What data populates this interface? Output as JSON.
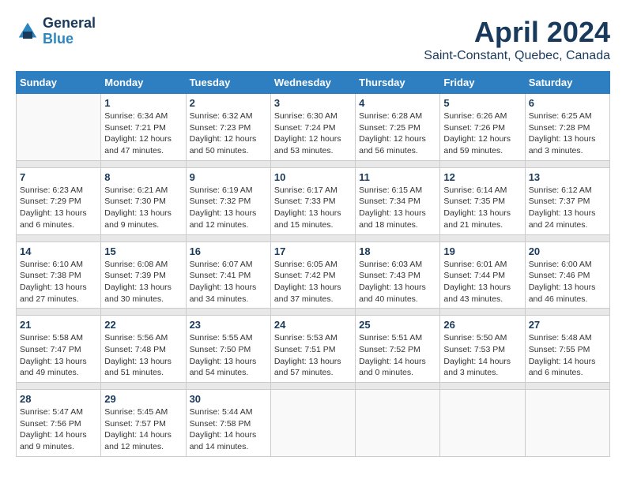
{
  "header": {
    "logo_line1": "General",
    "logo_line2": "Blue",
    "title": "April 2024",
    "subtitle": "Saint-Constant, Quebec, Canada"
  },
  "days_of_week": [
    "Sunday",
    "Monday",
    "Tuesday",
    "Wednesday",
    "Thursday",
    "Friday",
    "Saturday"
  ],
  "weeks": [
    [
      {
        "day": "",
        "sunrise": "",
        "sunset": "",
        "daylight": ""
      },
      {
        "day": "1",
        "sunrise": "Sunrise: 6:34 AM",
        "sunset": "Sunset: 7:21 PM",
        "daylight": "Daylight: 12 hours and 47 minutes."
      },
      {
        "day": "2",
        "sunrise": "Sunrise: 6:32 AM",
        "sunset": "Sunset: 7:23 PM",
        "daylight": "Daylight: 12 hours and 50 minutes."
      },
      {
        "day": "3",
        "sunrise": "Sunrise: 6:30 AM",
        "sunset": "Sunset: 7:24 PM",
        "daylight": "Daylight: 12 hours and 53 minutes."
      },
      {
        "day": "4",
        "sunrise": "Sunrise: 6:28 AM",
        "sunset": "Sunset: 7:25 PM",
        "daylight": "Daylight: 12 hours and 56 minutes."
      },
      {
        "day": "5",
        "sunrise": "Sunrise: 6:26 AM",
        "sunset": "Sunset: 7:26 PM",
        "daylight": "Daylight: 12 hours and 59 minutes."
      },
      {
        "day": "6",
        "sunrise": "Sunrise: 6:25 AM",
        "sunset": "Sunset: 7:28 PM",
        "daylight": "Daylight: 13 hours and 3 minutes."
      }
    ],
    [
      {
        "day": "7",
        "sunrise": "Sunrise: 6:23 AM",
        "sunset": "Sunset: 7:29 PM",
        "daylight": "Daylight: 13 hours and 6 minutes."
      },
      {
        "day": "8",
        "sunrise": "Sunrise: 6:21 AM",
        "sunset": "Sunset: 7:30 PM",
        "daylight": "Daylight: 13 hours and 9 minutes."
      },
      {
        "day": "9",
        "sunrise": "Sunrise: 6:19 AM",
        "sunset": "Sunset: 7:32 PM",
        "daylight": "Daylight: 13 hours and 12 minutes."
      },
      {
        "day": "10",
        "sunrise": "Sunrise: 6:17 AM",
        "sunset": "Sunset: 7:33 PM",
        "daylight": "Daylight: 13 hours and 15 minutes."
      },
      {
        "day": "11",
        "sunrise": "Sunrise: 6:15 AM",
        "sunset": "Sunset: 7:34 PM",
        "daylight": "Daylight: 13 hours and 18 minutes."
      },
      {
        "day": "12",
        "sunrise": "Sunrise: 6:14 AM",
        "sunset": "Sunset: 7:35 PM",
        "daylight": "Daylight: 13 hours and 21 minutes."
      },
      {
        "day": "13",
        "sunrise": "Sunrise: 6:12 AM",
        "sunset": "Sunset: 7:37 PM",
        "daylight": "Daylight: 13 hours and 24 minutes."
      }
    ],
    [
      {
        "day": "14",
        "sunrise": "Sunrise: 6:10 AM",
        "sunset": "Sunset: 7:38 PM",
        "daylight": "Daylight: 13 hours and 27 minutes."
      },
      {
        "day": "15",
        "sunrise": "Sunrise: 6:08 AM",
        "sunset": "Sunset: 7:39 PM",
        "daylight": "Daylight: 13 hours and 30 minutes."
      },
      {
        "day": "16",
        "sunrise": "Sunrise: 6:07 AM",
        "sunset": "Sunset: 7:41 PM",
        "daylight": "Daylight: 13 hours and 34 minutes."
      },
      {
        "day": "17",
        "sunrise": "Sunrise: 6:05 AM",
        "sunset": "Sunset: 7:42 PM",
        "daylight": "Daylight: 13 hours and 37 minutes."
      },
      {
        "day": "18",
        "sunrise": "Sunrise: 6:03 AM",
        "sunset": "Sunset: 7:43 PM",
        "daylight": "Daylight: 13 hours and 40 minutes."
      },
      {
        "day": "19",
        "sunrise": "Sunrise: 6:01 AM",
        "sunset": "Sunset: 7:44 PM",
        "daylight": "Daylight: 13 hours and 43 minutes."
      },
      {
        "day": "20",
        "sunrise": "Sunrise: 6:00 AM",
        "sunset": "Sunset: 7:46 PM",
        "daylight": "Daylight: 13 hours and 46 minutes."
      }
    ],
    [
      {
        "day": "21",
        "sunrise": "Sunrise: 5:58 AM",
        "sunset": "Sunset: 7:47 PM",
        "daylight": "Daylight: 13 hours and 49 minutes."
      },
      {
        "day": "22",
        "sunrise": "Sunrise: 5:56 AM",
        "sunset": "Sunset: 7:48 PM",
        "daylight": "Daylight: 13 hours and 51 minutes."
      },
      {
        "day": "23",
        "sunrise": "Sunrise: 5:55 AM",
        "sunset": "Sunset: 7:50 PM",
        "daylight": "Daylight: 13 hours and 54 minutes."
      },
      {
        "day": "24",
        "sunrise": "Sunrise: 5:53 AM",
        "sunset": "Sunset: 7:51 PM",
        "daylight": "Daylight: 13 hours and 57 minutes."
      },
      {
        "day": "25",
        "sunrise": "Sunrise: 5:51 AM",
        "sunset": "Sunset: 7:52 PM",
        "daylight": "Daylight: 14 hours and 0 minutes."
      },
      {
        "day": "26",
        "sunrise": "Sunrise: 5:50 AM",
        "sunset": "Sunset: 7:53 PM",
        "daylight": "Daylight: 14 hours and 3 minutes."
      },
      {
        "day": "27",
        "sunrise": "Sunrise: 5:48 AM",
        "sunset": "Sunset: 7:55 PM",
        "daylight": "Daylight: 14 hours and 6 minutes."
      }
    ],
    [
      {
        "day": "28",
        "sunrise": "Sunrise: 5:47 AM",
        "sunset": "Sunset: 7:56 PM",
        "daylight": "Daylight: 14 hours and 9 minutes."
      },
      {
        "day": "29",
        "sunrise": "Sunrise: 5:45 AM",
        "sunset": "Sunset: 7:57 PM",
        "daylight": "Daylight: 14 hours and 12 minutes."
      },
      {
        "day": "30",
        "sunrise": "Sunrise: 5:44 AM",
        "sunset": "Sunset: 7:58 PM",
        "daylight": "Daylight: 14 hours and 14 minutes."
      },
      {
        "day": "",
        "sunrise": "",
        "sunset": "",
        "daylight": ""
      },
      {
        "day": "",
        "sunrise": "",
        "sunset": "",
        "daylight": ""
      },
      {
        "day": "",
        "sunrise": "",
        "sunset": "",
        "daylight": ""
      },
      {
        "day": "",
        "sunrise": "",
        "sunset": "",
        "daylight": ""
      }
    ]
  ]
}
